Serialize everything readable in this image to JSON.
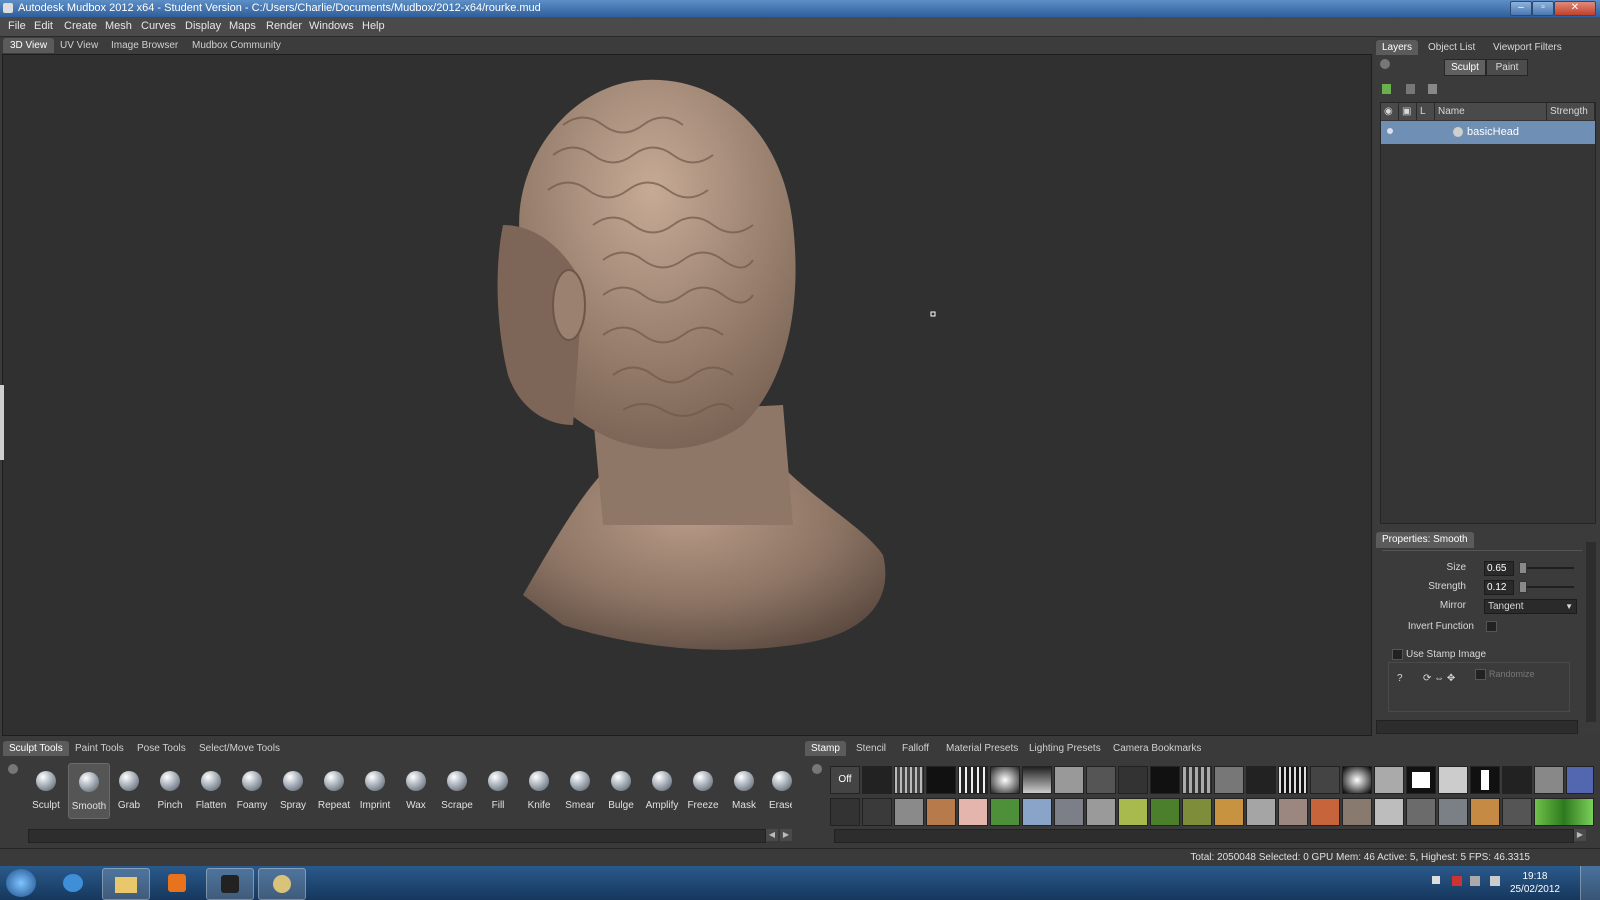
{
  "window": {
    "title": "Autodesk Mudbox 2012 x64 - Student Version - C:/Users/Charlie/Documents/Mudbox/2012-x64/rourke.mud"
  },
  "menu": [
    "File",
    "Edit",
    "Create",
    "Mesh",
    "Curves",
    "Display",
    "Maps",
    "Render",
    "Windows",
    "Help"
  ],
  "view_tabs": [
    "3D View",
    "UV View",
    "Image Browser",
    "Mudbox Community"
  ],
  "right_tabs": [
    "Layers",
    "Object List",
    "Viewport Filters"
  ],
  "layer_mode": [
    "Sculpt",
    "Paint"
  ],
  "layer_columns": {
    "lock": "L",
    "name": "Name",
    "strength": "Strength"
  },
  "layers": [
    {
      "name": "basicHead"
    }
  ],
  "properties": {
    "title": "Properties: Smooth",
    "size_label": "Size",
    "size": "0.65",
    "strength_label": "Strength",
    "strength": "0.12",
    "mirror_label": "Mirror",
    "mirror": "Tangent",
    "invert_label": "Invert Function",
    "use_stamp_label": "Use Stamp Image",
    "randomize_label": "Randomize"
  },
  "tool_tabs": [
    "Sculpt Tools",
    "Paint Tools",
    "Pose Tools",
    "Select/Move Tools"
  ],
  "tools": [
    "Sculpt",
    "Smooth",
    "Grab",
    "Pinch",
    "Flatten",
    "Foamy",
    "Spray",
    "Repeat",
    "Imprint",
    "Wax",
    "Scrape",
    "Fill",
    "Knife",
    "Smear",
    "Bulge",
    "Amplify",
    "Freeze",
    "Mask",
    "Erase"
  ],
  "active_tool": "Smooth",
  "stamp_tabs": [
    "Stamp",
    "Stencil",
    "Falloff",
    "Material Presets",
    "Lighting Presets",
    "Camera Bookmarks"
  ],
  "stamp_off_label": "Off",
  "status": "Total: 2050048  Selected: 0 GPU Mem: 46  Active: 5, Highest: 5  FPS: 46.3315",
  "clock": {
    "time": "19:18",
    "date": "25/02/2012"
  },
  "colors": {
    "head": "#9a8170",
    "selection": "#6f8fb4",
    "taskbar": "#1f4a78"
  }
}
